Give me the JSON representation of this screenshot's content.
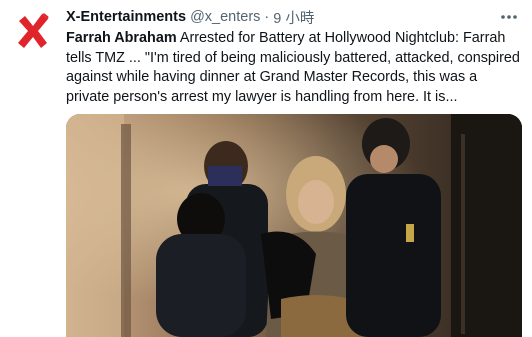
{
  "tweet": {
    "author": {
      "display_name": "X-Entertainments",
      "handle": "@x_enters",
      "avatar_icon": "red-x-logo-icon"
    },
    "separator": "·",
    "time": "9 小時",
    "more_icon": "more-options-icon",
    "text": {
      "bold_lead": "Farrah Abraham",
      "body": " Arrested for Battery at Hollywood Nightclub: Farrah tells TMZ ... \"I'm tired of being maliciously battered, attacked, conspired against while having dinner at Grand Master Records, this was a private person's arrest my lawyer is handling from here. It is..."
    },
    "media": {
      "kind": "photo"
    }
  },
  "colors": {
    "text_primary": "#0f1419",
    "text_secondary": "#536471",
    "logo_red": "#e0242b"
  }
}
